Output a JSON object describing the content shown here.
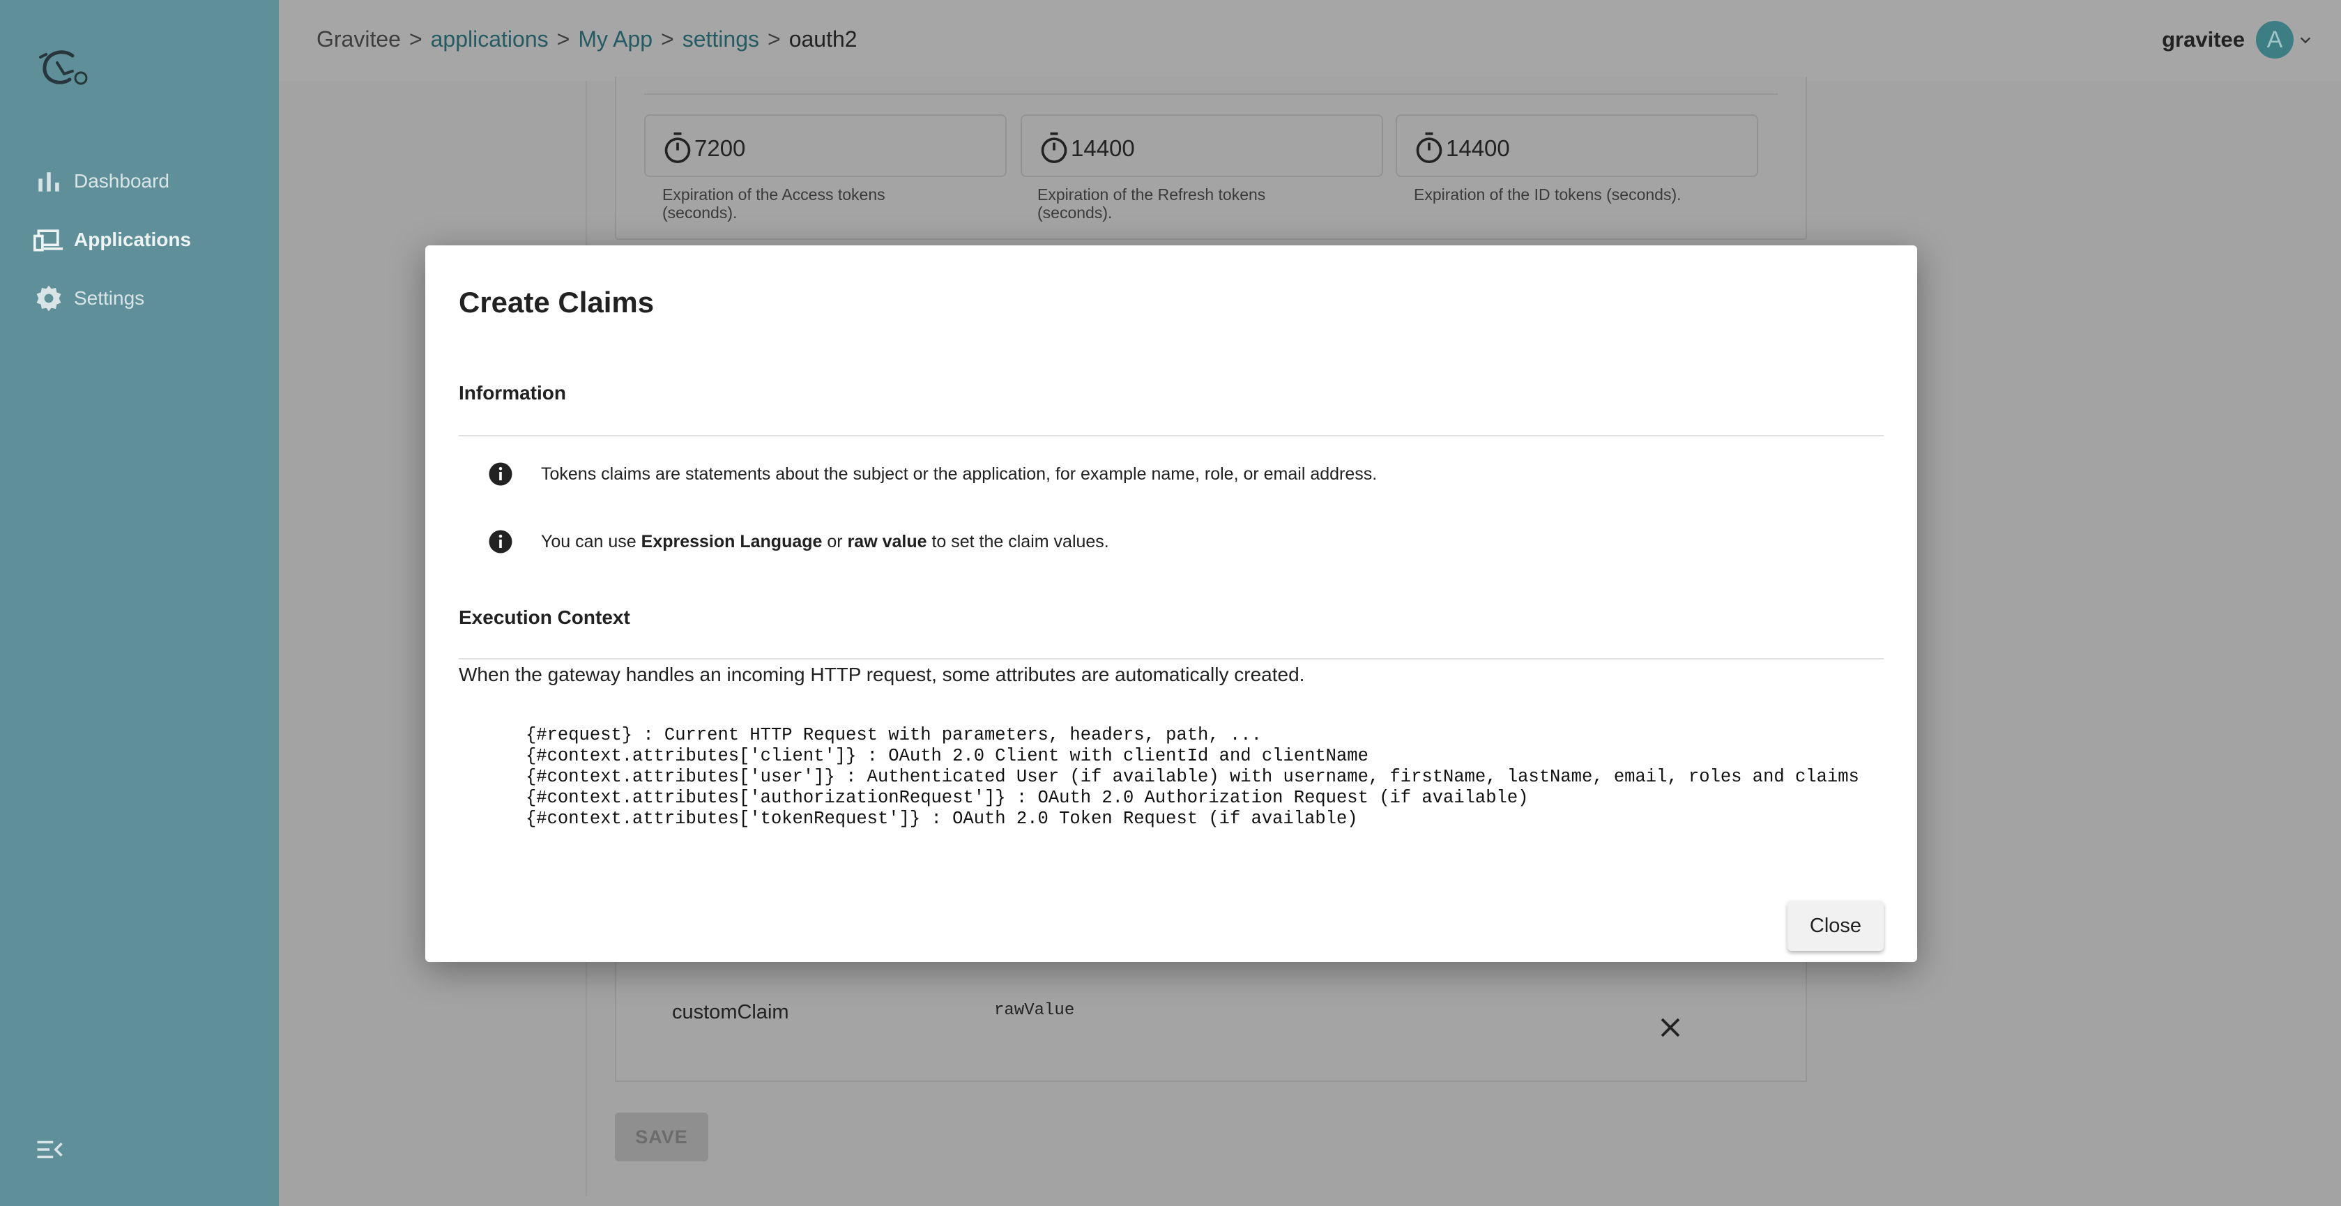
{
  "sidebar": {
    "logo_icon": "gravitee-logo-icon",
    "items": [
      {
        "label": "Dashboard",
        "icon": "bar-chart-icon"
      },
      {
        "label": "Applications",
        "icon": "devices-icon"
      },
      {
        "label": "Settings",
        "icon": "gear-icon"
      }
    ],
    "collapse_icon": "menu-collapse-icon"
  },
  "header": {
    "breadcrumb": [
      {
        "label": "Gravitee"
      },
      {
        "label": "applications"
      },
      {
        "label": "My App"
      },
      {
        "label": "settings"
      },
      {
        "label": "oauth2"
      }
    ],
    "separator": ">",
    "user_name": "gravitee",
    "avatar_initial": "A"
  },
  "tokens": [
    {
      "value": "7200",
      "hint": "Expiration of the Access tokens (seconds)."
    },
    {
      "value": "14400",
      "hint": "Expiration of the Refresh tokens (seconds)."
    },
    {
      "value": "14400",
      "hint": "Expiration of the ID tokens (seconds)."
    }
  ],
  "claims": [
    {
      "name": "customClaim",
      "value": "rawValue"
    }
  ],
  "save_label": "SAVE",
  "modal": {
    "title": "Create Claims",
    "information_title": "Information",
    "info1": "Tokens claims are statements about the subject or the application, for example name, role, or email address.",
    "info2_prefix": "You can use ",
    "info2_bold1": "Expression Language",
    "info2_mid": " or ",
    "info2_bold2": "raw value",
    "info2_suffix": " to set the claim values.",
    "execution_title": "Execution Context",
    "execution_desc": "When the gateway handles an incoming HTTP request, some attributes are automatically created.",
    "code_lines": [
      "{#request} : Current HTTP Request with parameters, headers, path, ...",
      "{#context.attributes['client']} : OAuth 2.0 Client with clientId and clientName",
      "{#context.attributes['user']} : Authenticated User (if available) with username, firstName, lastName, email, roles and claims",
      "{#context.attributes['authorizationRequest']} : OAuth 2.0 Authorization Request (if available)",
      "{#context.attributes['tokenRequest']} : OAuth 2.0 Token Request (if available)"
    ],
    "close_label": "Close"
  },
  "colors": {
    "sidebar": "#5f8f98",
    "overlay": "#a3a3a3",
    "link": "#245b62",
    "modal_bg": "#ffffff"
  }
}
